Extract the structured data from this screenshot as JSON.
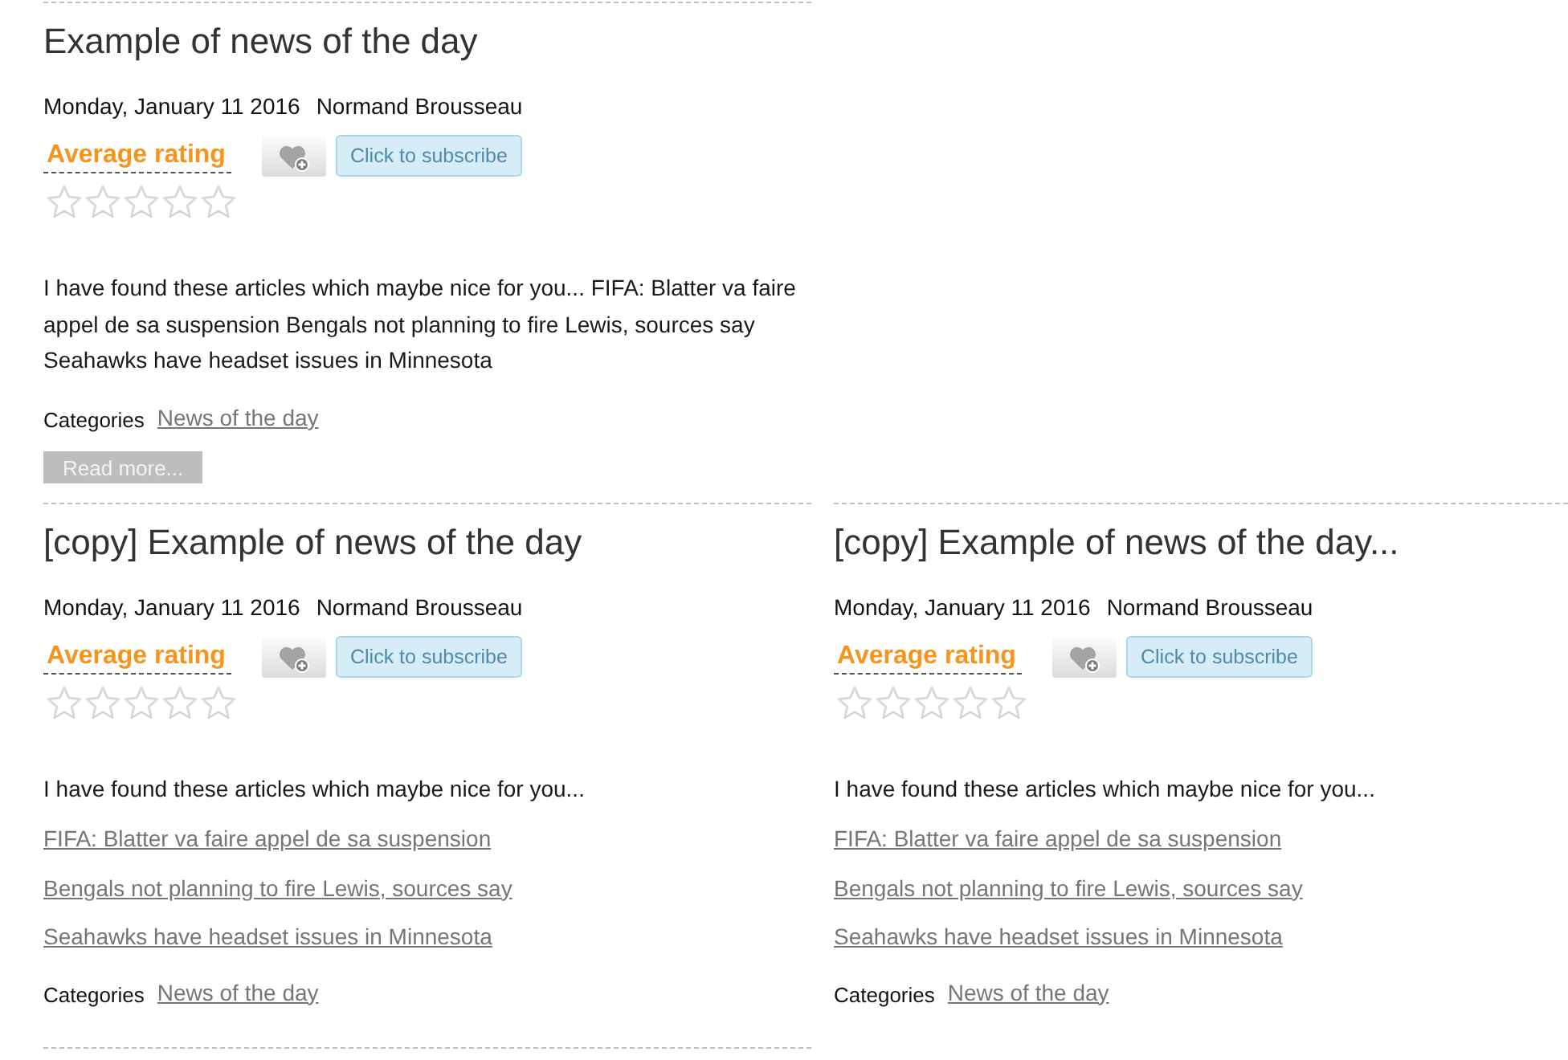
{
  "rows": [
    {
      "articles": [
        {
          "title": "Example of news of the day",
          "date": "Monday, January 11 2016",
          "author": "Normand Brousseau",
          "rating_label": "Average rating",
          "stars": 0,
          "subscribe": "Click to subscribe",
          "summary": "I have found these articles which maybe nice for you... FIFA: Blatter va faire appel de sa suspension Bengals not planning to fire Lewis, sources say Seahawks have headset issues in Minnesota",
          "categories_label": "Categories",
          "category": "News of the day",
          "read_more": "Read more..."
        }
      ]
    },
    {
      "articles": [
        {
          "title": "[copy] Example of news of the day",
          "date": "Monday, January 11 2016",
          "author": "Normand Brousseau",
          "rating_label": "Average rating",
          "stars": 0,
          "subscribe": "Click to subscribe",
          "intro": "I have found these articles which maybe nice for you...",
          "links": [
            "FIFA: Blatter va faire appel de sa suspension",
            "Bengals not planning to fire Lewis, sources say",
            "Seahawks have headset issues in Minnesota"
          ],
          "categories_label": "Categories",
          "category": "News of the day"
        },
        {
          "title": "[copy] Example of news of the day...",
          "date": "Monday, January 11 2016",
          "author": "Normand Brousseau",
          "rating_label": "Average rating",
          "stars": 0,
          "subscribe": "Click to subscribe",
          "intro": "I have found these articles which maybe nice for you...",
          "links": [
            "FIFA: Blatter va faire appel de sa suspension",
            "Bengals not planning to fire Lewis, sources say",
            "Seahawks have headset issues in Minnesota"
          ],
          "categories_label": "Categories",
          "category": "News of the day"
        }
      ]
    }
  ]
}
